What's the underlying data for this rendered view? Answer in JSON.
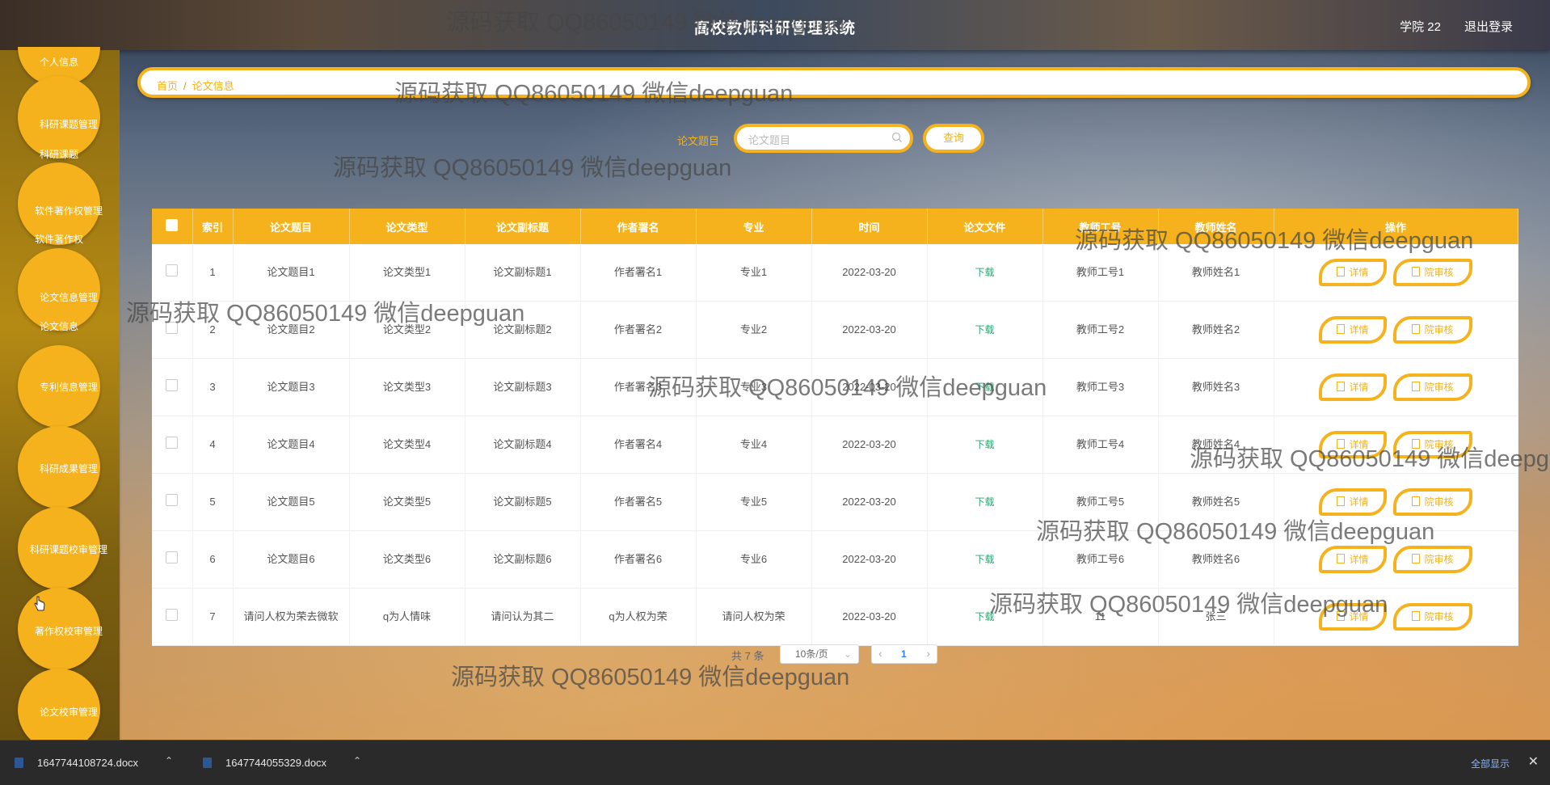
{
  "header": {
    "title": "高校教师科研管理系统",
    "user": "学院 22",
    "logout": "退出登录"
  },
  "sidebar": {
    "items": [
      {
        "label": "个人信息"
      },
      {
        "label": "科研课题管理",
        "sub": "科研课题"
      },
      {
        "label": "软件著作权管理",
        "sub": "软件著作权"
      },
      {
        "label": "论文信息管理",
        "sub": "论文信息"
      },
      {
        "label": "专利信息管理"
      },
      {
        "label": "科研成果管理"
      },
      {
        "label": "科研课题校审管理"
      },
      {
        "label": "著作权校审管理"
      },
      {
        "label": "论文校审管理"
      }
    ]
  },
  "breadcrumb": {
    "home": "首页",
    "sep": "/",
    "current": "论文信息"
  },
  "search": {
    "label": "论文题目",
    "placeholder": "论文题目",
    "button": "查询"
  },
  "table": {
    "headers": [
      "索引",
      "论文题目",
      "论文类型",
      "论文副标题",
      "作者署名",
      "专业",
      "时间",
      "论文文件",
      "教师工号",
      "教师姓名",
      "操作"
    ],
    "download_label": "下载",
    "detail_label": "详情",
    "review_label": "院审核",
    "rows": [
      {
        "index": "1",
        "title": "论文题目1",
        "type": "论文类型1",
        "subtitle": "论文副标题1",
        "author": "作者署名1",
        "major": "专业1",
        "time": "2022-03-20",
        "teacher_no": "教师工号1",
        "teacher_name": "教师姓名1"
      },
      {
        "index": "2",
        "title": "论文题目2",
        "type": "论文类型2",
        "subtitle": "论文副标题2",
        "author": "作者署名2",
        "major": "专业2",
        "time": "2022-03-20",
        "teacher_no": "教师工号2",
        "teacher_name": "教师姓名2"
      },
      {
        "index": "3",
        "title": "论文题目3",
        "type": "论文类型3",
        "subtitle": "论文副标题3",
        "author": "作者署名3",
        "major": "专业3",
        "time": "2022-03-20",
        "teacher_no": "教师工号3",
        "teacher_name": "教师姓名3"
      },
      {
        "index": "4",
        "title": "论文题目4",
        "type": "论文类型4",
        "subtitle": "论文副标题4",
        "author": "作者署名4",
        "major": "专业4",
        "time": "2022-03-20",
        "teacher_no": "教师工号4",
        "teacher_name": "教师姓名4"
      },
      {
        "index": "5",
        "title": "论文题目5",
        "type": "论文类型5",
        "subtitle": "论文副标题5",
        "author": "作者署名5",
        "major": "专业5",
        "time": "2022-03-20",
        "teacher_no": "教师工号5",
        "teacher_name": "教师姓名5"
      },
      {
        "index": "6",
        "title": "论文题目6",
        "type": "论文类型6",
        "subtitle": "论文副标题6",
        "author": "作者署名6",
        "major": "专业6",
        "time": "2022-03-20",
        "teacher_no": "教师工号6",
        "teacher_name": "教师姓名6"
      },
      {
        "index": "7",
        "title": "请问人权为荣去微软",
        "type": "q为人情味",
        "subtitle": "请问认为其二",
        "author": "q为人权为荣",
        "major": "请问人权为荣",
        "time": "2022-03-20",
        "teacher_no": "11",
        "teacher_name": "张三"
      }
    ]
  },
  "pagination": {
    "total": "共 7 条",
    "page_size": "10条/页",
    "current_page": "1"
  },
  "downloads": {
    "files": [
      "1647744108724.docx",
      "1647744055329.docx"
    ],
    "show_all": "全部显示"
  },
  "watermark": "源码获取 QQ86050149 微信deepguan",
  "colors": {
    "accent": "#f5b21c",
    "download_link": "#2ba471"
  }
}
